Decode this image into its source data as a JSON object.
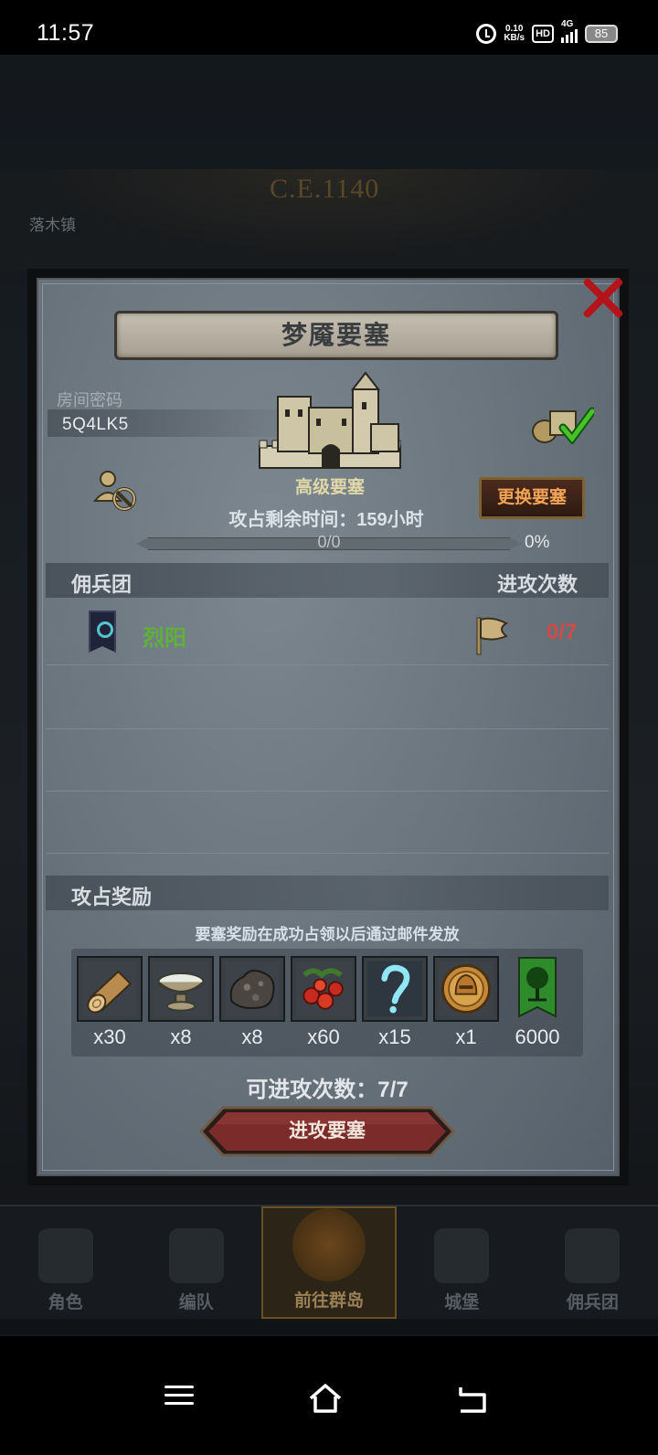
{
  "status_bar": {
    "time": "11:57",
    "net_speed_value": "0.10",
    "net_speed_unit": "KB/s",
    "hd": "HD",
    "network": "4G",
    "battery": "85"
  },
  "scene": {
    "era": "C.E.1140",
    "town": "落木镇"
  },
  "dialog": {
    "title": "梦魇要塞",
    "room_code_label": "房间密码",
    "room_code": "5Q4LK5",
    "fortress_level": "高级要塞",
    "change_button": "更换要塞",
    "time_left": "攻占剩余时间：159小时",
    "progress_text": "0/0",
    "progress_percent": "0%",
    "progress_value": 0,
    "mercenary_header": "佣兵团",
    "attacks_header": "进攻次数",
    "mercenaries": [
      {
        "name": "烈阳",
        "attacks": "0/7"
      }
    ],
    "reward_header": "攻占奖励",
    "reward_note": "要塞奖励在成功占领以后通过邮件发放",
    "rewards": [
      {
        "icon": "wood-log-icon",
        "qty": "x30"
      },
      {
        "icon": "stone-bowl-icon",
        "qty": "x8"
      },
      {
        "icon": "ore-rock-icon",
        "qty": "x8"
      },
      {
        "icon": "berry-fruit-icon",
        "qty": "x60"
      },
      {
        "icon": "question-mark-icon",
        "qty": "x15"
      },
      {
        "icon": "helmet-medal-icon",
        "qty": "x1"
      },
      {
        "icon": "tree-banner-icon",
        "qty": "6000"
      }
    ],
    "remaining_attacks": "可进攻次数：7/7",
    "attack_button": "进攻要塞"
  },
  "tabs": [
    {
      "label": "角色",
      "active": false
    },
    {
      "label": "编队",
      "active": false
    },
    {
      "label": "前往群岛",
      "active": true
    },
    {
      "label": "城堡",
      "active": false
    },
    {
      "label": "佣兵团",
      "active": false
    }
  ],
  "colors": {
    "accent_gold": "#c69a4f",
    "merc_name_green": "#5fb13a",
    "count_red": "#cf4c47",
    "close_red": "#b4131a",
    "change_text": "#f3a456"
  }
}
